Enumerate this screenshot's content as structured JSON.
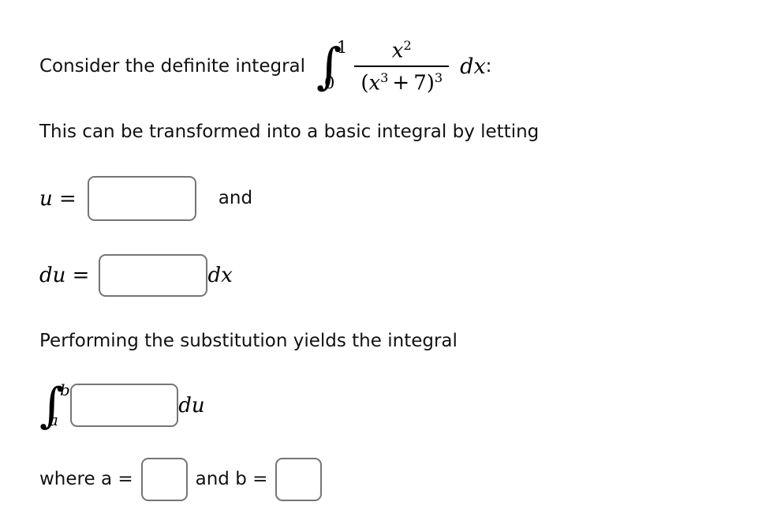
{
  "problem": {
    "line1_lead": "Consider the definite integral",
    "integral": {
      "lower_limit": "0",
      "upper_limit": "1",
      "numerator_base": "x",
      "numerator_exponent": "2",
      "denominator_open": "(",
      "denominator_base": "x",
      "denominator_base_exponent": "3",
      "denominator_plus": "+",
      "denominator_constant": "7",
      "denominator_close": ")",
      "denominator_exponent": "3",
      "differential": "dx",
      "trailing_colon": ":"
    },
    "line2": "This can be transformed into a basic integral by letting",
    "u_row": {
      "label": "u =",
      "input_value": "",
      "input_placeholder": "",
      "after_text": "and"
    },
    "du_row": {
      "label": "du =",
      "input_value": "",
      "input_placeholder": "",
      "after_text": "dx"
    },
    "line3": "Performing the substitution yields the integral",
    "integral_row": {
      "lower_limit": "a",
      "upper_limit": "b",
      "input_value": "",
      "input_placeholder": "",
      "after_text": "du"
    },
    "ab_row": {
      "text_before": "where a =",
      "a_value": "",
      "a_placeholder": "",
      "text_between": "and b =",
      "b_value": "",
      "b_placeholder": ""
    }
  },
  "style": {
    "page_background": "#ffffff",
    "text_color": "#111111",
    "input_border_color": "#757575"
  }
}
